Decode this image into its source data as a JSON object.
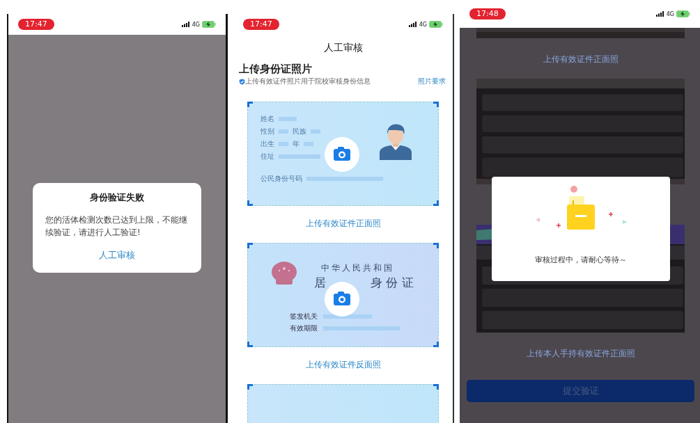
{
  "failure_screen": {
    "status_bar": {
      "time": "17:47",
      "network": "4G"
    },
    "dialog": {
      "title": "身份验证失败",
      "message": "您的活体检测次数已达到上限，不能继续验证，请进行人工验证!",
      "action": "人工审核"
    }
  },
  "review_screen": {
    "status_bar": {
      "time": "17:47",
      "network": "4G"
    },
    "title": "人工审核",
    "section_title": "上传身份证照片",
    "note": "上传有效证件照片用于院校审核身份信息",
    "requirements_link": "照片要求",
    "front_card": {
      "rows": [
        [
          "姓名"
        ],
        [
          "性别",
          "民族"
        ],
        [
          "出生",
          "年"
        ],
        [
          "住址"
        ]
      ],
      "id_label": "公民身份号码"
    },
    "front_caption": "上传有效证件正面照",
    "back_card": {
      "country": "中华人民共和国",
      "title_left": "居",
      "title_right": "身 份 证",
      "fields": [
        "签发机关",
        "有效期限"
      ]
    },
    "back_caption": "上传有效证件反面照"
  },
  "pending_screen": {
    "status_bar": {
      "time": "17:48",
      "network": "4G"
    },
    "front_caption": "上传有效证件正面照",
    "hand_caption": "上传本人手持有效证件正面照",
    "submit": "提交验证",
    "dialog": {
      "message": "审核过程中，请耐心等待～"
    }
  }
}
